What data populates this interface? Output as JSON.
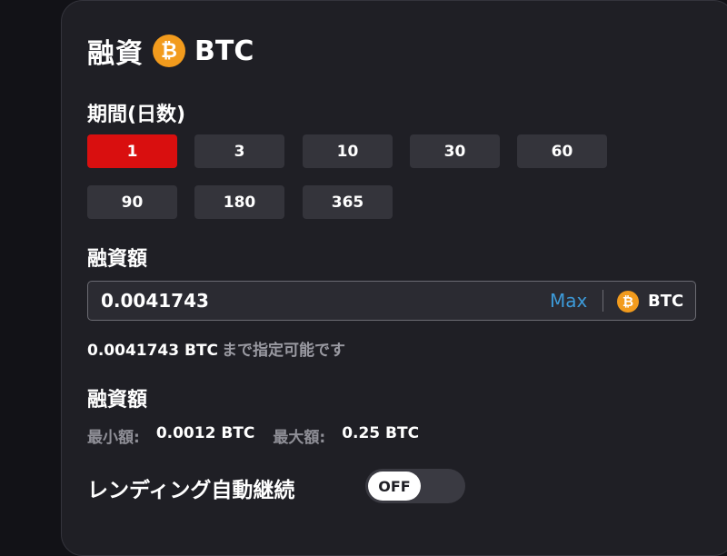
{
  "header": {
    "title": "融資",
    "coin_symbol": "₿",
    "coin_name": "BTC"
  },
  "period": {
    "label": "期間(日数)",
    "options": [
      "1",
      "3",
      "10",
      "30",
      "60",
      "90",
      "180",
      "365"
    ],
    "selected": "1"
  },
  "amount": {
    "label": "融資額",
    "value": "0.0041743",
    "max_label": "Max",
    "coin_symbol": "₿",
    "coin_name": "BTC",
    "available_value": "0.0041743 BTC",
    "available_suffix": "まで指定可能です"
  },
  "limits": {
    "label": "融資額",
    "min_label": "最小額:",
    "min_value": "0.0012 BTC",
    "max_label": "最大額:",
    "max_value": "0.25 BTC"
  },
  "auto_renew": {
    "label": "レンディング自動継続",
    "state": "OFF"
  },
  "colors": {
    "accent_red": "#d90f0f",
    "btc_orange": "#f29b1d",
    "link_blue": "#3d9ad8",
    "panel": "#1f1f25"
  }
}
